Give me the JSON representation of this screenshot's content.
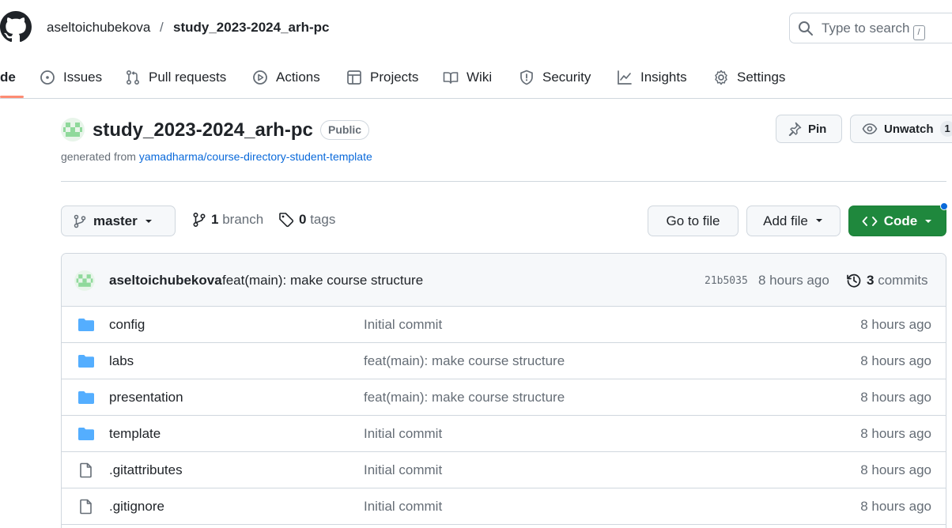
{
  "header": {
    "owner": "aseltoichubekova",
    "separator": "/",
    "repo": "study_2023-2024_arh-pc",
    "search_placeholder": "Type to search",
    "search_shortcut": "/"
  },
  "tabs": [
    {
      "label": "de",
      "icon": "code-icon"
    },
    {
      "label": "Issues",
      "icon": "issue-icon"
    },
    {
      "label": "Pull requests",
      "icon": "pull-request-icon"
    },
    {
      "label": "Actions",
      "icon": "play-icon"
    },
    {
      "label": "Projects",
      "icon": "table-icon"
    },
    {
      "label": "Wiki",
      "icon": "book-icon"
    },
    {
      "label": "Security",
      "icon": "shield-icon"
    },
    {
      "label": "Insights",
      "icon": "graph-icon"
    },
    {
      "label": "Settings",
      "icon": "gear-icon"
    }
  ],
  "repo": {
    "name": "study_2023-2024_arh-pc",
    "visibility": "Public",
    "generated_prefix": "generated from",
    "template_link": "yamadharma/course-directory-student-template",
    "pin_label": "Pin",
    "watch_label": "Unwatch",
    "watch_count": "1"
  },
  "toolbar": {
    "branch": "master",
    "branch_count": "1",
    "branch_word": "branch",
    "tag_count": "0",
    "tag_word": "tags",
    "goto_file": "Go to file",
    "add_file": "Add file",
    "code": "Code"
  },
  "latest_commit": {
    "author": "aseltoichubekova",
    "message": "feat(main): make course structure",
    "sha": "21b5035",
    "time": "8 hours ago",
    "count": "3",
    "count_word": "commits"
  },
  "files": [
    {
      "name": "config",
      "type": "dir",
      "message": "Initial commit",
      "time": "8 hours ago"
    },
    {
      "name": "labs",
      "type": "dir",
      "message": "feat(main): make course structure",
      "time": "8 hours ago"
    },
    {
      "name": "presentation",
      "type": "dir",
      "message": "feat(main): make course structure",
      "time": "8 hours ago"
    },
    {
      "name": "template",
      "type": "dir",
      "message": "Initial commit",
      "time": "8 hours ago"
    },
    {
      "name": ".gitattributes",
      "type": "file",
      "message": "Initial commit",
      "time": "8 hours ago"
    },
    {
      "name": ".gitignore",
      "type": "file",
      "message": "Initial commit",
      "time": "8 hours ago"
    }
  ],
  "colors": {
    "accent": "#0969da",
    "code_button": "#1f883d",
    "tab_underline": "#fd8c73",
    "folder": "#54aeff",
    "identicon": "#8fd99b"
  }
}
